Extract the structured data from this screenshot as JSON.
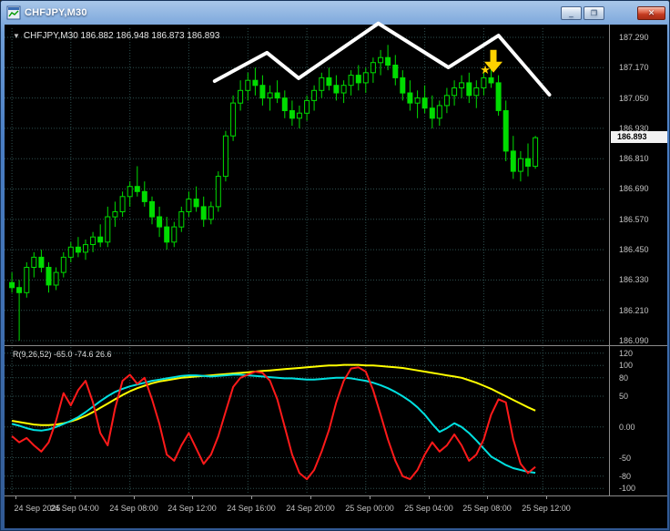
{
  "window": {
    "title": "CHFJPY,M30",
    "buttons": {
      "minimize": "_",
      "restore": "❐",
      "close": "✕"
    }
  },
  "chart": {
    "header_arrow": "▼",
    "header": "CHFJPY,M30 186.882 186.948 186.873 186.893",
    "price_axis": {
      "labels": [
        "187.290",
        "187.170",
        "187.050",
        "186.930",
        "186.810",
        "186.690",
        "186.570",
        "186.450",
        "186.330",
        "186.210",
        "186.090"
      ],
      "current": "186.893"
    },
    "time_axis": {
      "labels": [
        {
          "text": "24 Sep 2025",
          "bar": 0
        },
        {
          "text": "24 Sep 04:00",
          "bar": 8
        },
        {
          "text": "24 Sep 08:00",
          "bar": 16
        },
        {
          "text": "24 Sep 12:00",
          "bar": 24
        },
        {
          "text": "24 Sep 16:00",
          "bar": 32
        },
        {
          "text": "24 Sep 20:00",
          "bar": 40
        },
        {
          "text": "25 Sep 00:00",
          "bar": 48
        },
        {
          "text": "25 Sep 04:00",
          "bar": 56
        },
        {
          "text": "25 Sep 08:00",
          "bar": 64
        },
        {
          "text": "25 Sep 12:00",
          "bar": 72
        }
      ]
    }
  },
  "indicator": {
    "label": "R(9,26,52) -65.0 -74.6 26.6",
    "axis_labels": [
      "120",
      "100",
      "80",
      "50",
      "0.00",
      "-50",
      "-80",
      "-100"
    ]
  },
  "chart_data": {
    "type": "candlestick",
    "symbol": "CHFJPY",
    "timeframe": "M30",
    "colors": {
      "background": "#000000",
      "grid": "#2e5050",
      "candle": "#00dc00",
      "zigzag": "#ffffff",
      "arrow": "#ffd200",
      "wpr_fast": "#ff1a1a",
      "wpr_mid": "#00e0e0",
      "wpr_slow": "#ffff00"
    },
    "price_scale": {
      "top": 187.326,
      "bottom": 186.072
    },
    "ohlc": [
      [
        186.32,
        186.36,
        186.28,
        186.3
      ],
      [
        186.3,
        186.33,
        186.09,
        186.28
      ],
      [
        186.28,
        186.4,
        186.26,
        186.38
      ],
      [
        186.38,
        186.44,
        186.34,
        186.42
      ],
      [
        186.42,
        186.45,
        186.36,
        186.38
      ],
      [
        186.38,
        186.4,
        186.28,
        186.31
      ],
      [
        186.31,
        186.38,
        186.29,
        186.36
      ],
      [
        186.36,
        186.44,
        186.34,
        186.42
      ],
      [
        186.42,
        186.48,
        186.4,
        186.46
      ],
      [
        186.46,
        186.5,
        186.42,
        186.44
      ],
      [
        186.44,
        186.49,
        186.41,
        186.47
      ],
      [
        186.47,
        186.52,
        186.44,
        186.5
      ],
      [
        186.5,
        186.55,
        186.46,
        186.48
      ],
      [
        186.48,
        186.62,
        186.46,
        186.58
      ],
      [
        186.58,
        186.64,
        186.54,
        186.6
      ],
      [
        186.6,
        186.68,
        186.58,
        186.66
      ],
      [
        186.66,
        186.72,
        186.62,
        186.7
      ],
      [
        186.7,
        186.78,
        186.66,
        186.68
      ],
      [
        186.68,
        186.72,
        186.62,
        186.64
      ],
      [
        186.64,
        186.66,
        186.55,
        186.58
      ],
      [
        186.58,
        186.62,
        186.5,
        186.54
      ],
      [
        186.54,
        186.58,
        186.45,
        186.48
      ],
      [
        186.48,
        186.56,
        186.46,
        186.54
      ],
      [
        186.54,
        186.62,
        186.52,
        186.6
      ],
      [
        186.6,
        186.68,
        186.58,
        186.65
      ],
      [
        186.65,
        186.7,
        186.6,
        186.62
      ],
      [
        186.62,
        186.66,
        186.54,
        186.57
      ],
      [
        186.57,
        186.64,
        186.55,
        186.62
      ],
      [
        186.62,
        186.76,
        186.6,
        186.74
      ],
      [
        186.74,
        186.92,
        186.72,
        186.9
      ],
      [
        186.9,
        187.06,
        186.88,
        187.03
      ],
      [
        187.03,
        187.12,
        187.0,
        187.08
      ],
      [
        187.08,
        187.15,
        187.04,
        187.12
      ],
      [
        187.12,
        187.17,
        187.06,
        187.1
      ],
      [
        187.1,
        187.14,
        187.02,
        187.05
      ],
      [
        187.05,
        187.1,
        187.0,
        187.07
      ],
      [
        187.07,
        187.12,
        187.03,
        187.05
      ],
      [
        187.05,
        187.08,
        186.97,
        187.0
      ],
      [
        187.0,
        187.04,
        186.94,
        186.97
      ],
      [
        186.97,
        187.02,
        186.93,
        186.99
      ],
      [
        186.99,
        187.06,
        186.96,
        187.04
      ],
      [
        187.04,
        187.1,
        187.0,
        187.08
      ],
      [
        187.08,
        187.15,
        187.05,
        187.13
      ],
      [
        187.13,
        187.17,
        187.08,
        187.1
      ],
      [
        187.1,
        187.14,
        187.04,
        187.07
      ],
      [
        187.07,
        187.12,
        187.03,
        187.1
      ],
      [
        187.1,
        187.16,
        187.06,
        187.14
      ],
      [
        187.14,
        187.18,
        187.08,
        187.11
      ],
      [
        187.11,
        187.17,
        187.07,
        187.15
      ],
      [
        187.15,
        187.21,
        187.11,
        187.19
      ],
      [
        187.19,
        187.24,
        187.14,
        187.21
      ],
      [
        187.21,
        187.26,
        187.16,
        187.18
      ],
      [
        187.18,
        187.22,
        187.1,
        187.13
      ],
      [
        187.13,
        187.16,
        187.04,
        187.07
      ],
      [
        187.07,
        187.12,
        187.0,
        187.03
      ],
      [
        187.03,
        187.08,
        186.97,
        187.05
      ],
      [
        187.05,
        187.1,
        186.99,
        187.01
      ],
      [
        187.01,
        187.06,
        186.93,
        186.97
      ],
      [
        186.97,
        187.04,
        186.94,
        187.02
      ],
      [
        187.02,
        187.09,
        186.99,
        187.06
      ],
      [
        187.06,
        187.12,
        187.02,
        187.09
      ],
      [
        187.09,
        187.14,
        187.05,
        187.11
      ],
      [
        187.11,
        187.15,
        187.03,
        187.06
      ],
      [
        187.06,
        187.12,
        187.01,
        187.09
      ],
      [
        187.09,
        187.16,
        187.06,
        187.13
      ],
      [
        187.13,
        187.17,
        187.09,
        187.11
      ],
      [
        187.11,
        187.14,
        186.98,
        187.0
      ],
      [
        187.0,
        187.04,
        186.8,
        186.84
      ],
      [
        186.84,
        186.9,
        186.73,
        186.76
      ],
      [
        186.76,
        186.84,
        186.72,
        186.81
      ],
      [
        186.81,
        186.87,
        186.74,
        186.78
      ],
      [
        186.78,
        186.9,
        186.77,
        186.893
      ]
    ],
    "zigzag": [
      {
        "bar": 27.5,
        "price": 187.117
      },
      {
        "bar": 34.6,
        "price": 187.229
      },
      {
        "bar": 38.9,
        "price": 187.128
      },
      {
        "bar": 49.7,
        "price": 187.345
      },
      {
        "bar": 59.2,
        "price": 187.171
      },
      {
        "bar": 66.0,
        "price": 187.297
      },
      {
        "bar": 72.9,
        "price": 187.063
      }
    ],
    "annotations": [
      {
        "type": "arrow-down",
        "bar": 65.3,
        "price": 187.15
      },
      {
        "type": "star",
        "glyph": "★",
        "bar": 64.2,
        "price": 187.16
      }
    ],
    "indicator": {
      "range": [
        130,
        -110
      ],
      "slow": [
        10,
        8,
        6,
        4,
        3,
        3,
        4,
        6,
        9,
        13,
        18,
        24,
        31,
        38,
        45,
        52,
        58,
        63,
        67,
        71,
        74,
        76,
        78,
        80,
        81,
        82,
        83,
        84,
        85,
        86,
        87,
        88,
        89,
        90,
        91,
        92,
        93,
        94,
        95,
        96,
        97,
        98,
        99,
        100,
        100,
        101,
        101,
        101,
        100,
        100,
        99,
        98,
        97,
        96,
        94,
        92,
        90,
        88,
        86,
        84,
        82,
        80,
        76,
        72,
        67,
        62,
        56,
        50,
        44,
        38,
        32,
        26.6
      ],
      "mid": [
        5,
        2,
        -2,
        -5,
        -6,
        -4,
        0,
        5,
        10,
        16,
        24,
        33,
        42,
        50,
        57,
        62,
        66,
        69,
        72,
        75,
        77,
        79,
        81,
        83,
        84,
        84,
        83,
        82,
        83,
        84,
        85,
        85,
        84,
        83,
        82,
        81,
        80,
        79,
        79,
        78,
        77,
        77,
        78,
        79,
        80,
        80,
        79,
        77,
        75,
        72,
        68,
        63,
        57,
        50,
        42,
        32,
        20,
        5,
        -8,
        -2,
        6,
        0,
        -10,
        -22,
        -35,
        -48,
        -55,
        -62,
        -67,
        -70,
        -73,
        -74.6
      ],
      "fast": [
        -15,
        -25,
        -18,
        -30,
        -40,
        -25,
        10,
        55,
        35,
        60,
        75,
        40,
        -10,
        -30,
        30,
        75,
        85,
        70,
        80,
        45,
        5,
        -45,
        -55,
        -30,
        -10,
        -35,
        -60,
        -45,
        -15,
        25,
        65,
        80,
        85,
        90,
        88,
        75,
        45,
        0,
        -45,
        -75,
        -85,
        -70,
        -40,
        -5,
        40,
        75,
        95,
        97,
        90,
        60,
        20,
        -20,
        -55,
        -80,
        -85,
        -70,
        -45,
        -25,
        -40,
        -30,
        -12,
        -30,
        -55,
        -45,
        -20,
        20,
        45,
        40,
        -20,
        -60,
        -75,
        -65
      ]
    }
  }
}
